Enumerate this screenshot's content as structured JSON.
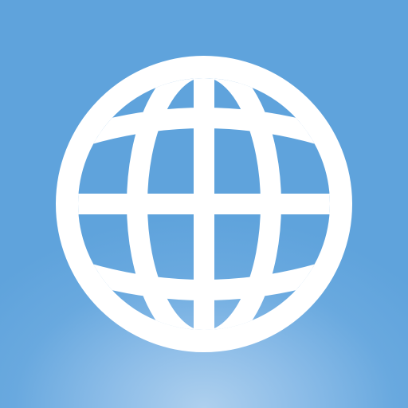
{
  "app_icon": {
    "icon": "globe-icon",
    "background_color": "#5fa3dc",
    "background_glow_color": "#aed0ee",
    "glyph_color": "#ffffff"
  }
}
